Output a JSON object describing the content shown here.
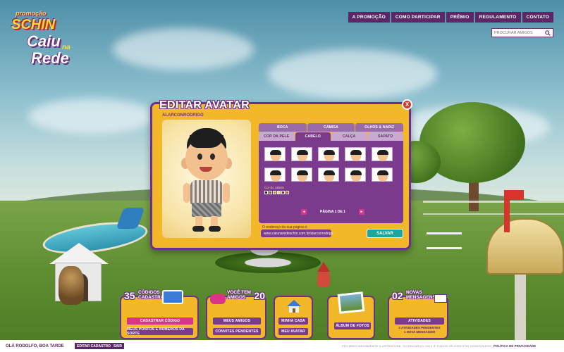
{
  "logo": {
    "promo_text": "promoção",
    "brand": "SCHIN",
    "line1": "Caiu",
    "line2": "na",
    "line3": "Rede"
  },
  "top_nav": {
    "items": [
      {
        "label": "A PROMOÇÃO"
      },
      {
        "label": "COMO PARTICIPAR"
      },
      {
        "label": "PRÊMIO"
      },
      {
        "label": "REGULAMENTO"
      },
      {
        "label": "CONTATO"
      }
    ]
  },
  "search": {
    "placeholder": "PROCURAR AMIGOS",
    "icon": "search-icon"
  },
  "modal": {
    "title": "EDITAR AVATAR",
    "close_label": "X",
    "username": "ALARCONRODRIGO",
    "tabs_back": [
      {
        "label": "BOCA"
      },
      {
        "label": "CAMISA"
      },
      {
        "label": "OLHOS & NARIZ"
      }
    ],
    "tabs_front": [
      {
        "label": "COR DA PELE"
      },
      {
        "label": "CABELO",
        "active": true
      },
      {
        "label": "CALÇA"
      },
      {
        "label": "SAPATO"
      }
    ],
    "hair_color_label": "Cor do cabelo",
    "hair_colors": [
      "#3a2a1a",
      "#7a4a2a",
      "#c98a3a",
      "#f0d060",
      "#8a2a2a",
      "#c05030"
    ],
    "pager": {
      "prev": "◄",
      "text": "PÁGINA 1 DE 1",
      "next": "►"
    },
    "url_label": "O endereço da sua página é:",
    "url_value": "www.caiunaredeschin.com.br/alarconrodrigo",
    "save_label": "SALVAR"
  },
  "cards": {
    "codes": {
      "number": "35",
      "title_line1": "CÓDIGOS",
      "title_line2": "CADASTRADOS",
      "btn_primary": "CADASTRAR CÓDIGO",
      "btn_secondary": "MEUS PONTOS E NÚMEROS DA SORTE"
    },
    "friends": {
      "title_line1": "VOCÊ TEM",
      "title_line2": "AMIGOS",
      "number": "20",
      "btn_primary": "MEUS AMIGOS",
      "btn_secondary": "CONVITES PENDENTES"
    },
    "house": {
      "btn_primary": "MINHA CASA",
      "btn_secondary": "MEU AVATAR"
    },
    "album": {
      "btn_primary": "ÁLBUM DE FOTOS"
    },
    "messages": {
      "number": "02",
      "title_line1": "NOVAS",
      "title_line2": "MENSAGENS",
      "btn_primary": "ATIVIDADES",
      "note_line1": "2 ATIVIDADES PENDENTES",
      "note_line2": "1 NOVA MENSAGEM"
    }
  },
  "footer": {
    "greeting": "OLÁ RODOLFO, BOA TARDE",
    "edit_label": "EDITAR CADASTRO",
    "logout_label": "SAIR",
    "copyright": "PROIBIDO NEGAMENTE ILUSTRATURA. SCHINCARIOL 2010 ® TODOS OS DIREITOS RESERVADOS",
    "privacy": "POLÍTICA DE PRIVACIDADE"
  },
  "colors": {
    "primary_purple": "#5b2766",
    "modal_yellow": "#f2b82a",
    "accent_pink": "#d8348a",
    "save_teal": "#1aa89a"
  }
}
